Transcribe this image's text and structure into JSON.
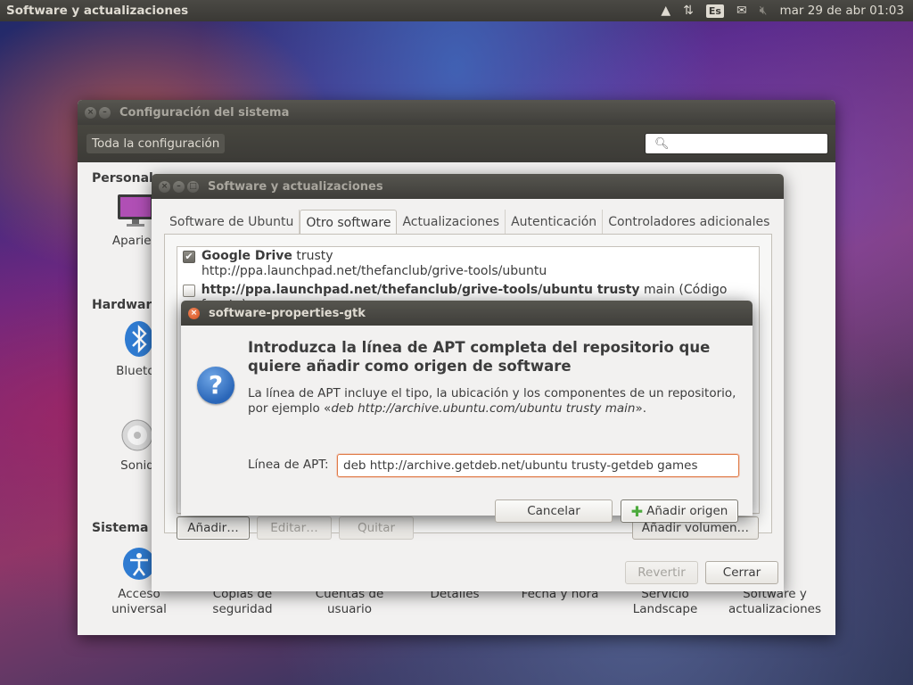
{
  "top_panel": {
    "app_title": "Software y actualizaciones",
    "language": "Es",
    "clock": "mar 29 de abr 01:03"
  },
  "settings": {
    "title": "Configuración del sistema",
    "all_settings": "Toda la configuración",
    "search_placeholder": "",
    "sections": {
      "personal": "Personal",
      "hardware": "Hardware",
      "system": "Sistema"
    },
    "personal_items": [
      "Aparien"
    ],
    "hardware_items": [
      "Bluetoo",
      "Sonid"
    ],
    "system_items": [
      {
        "line1": "Acceso",
        "line2": "universal"
      },
      {
        "line1": "Copias de",
        "line2": "seguridad"
      },
      {
        "line1": "Cuentas de",
        "line2": "usuario"
      },
      {
        "line1": "Detalles",
        "line2": ""
      },
      {
        "line1": "Fecha y hora",
        "line2": ""
      },
      {
        "line1": "Servicio",
        "line2": "Landscape"
      },
      {
        "line1": "Software y",
        "line2": "actualizaciones"
      }
    ]
  },
  "software": {
    "title": "Software y actualizaciones",
    "tabs": [
      "Software de Ubuntu",
      "Otro software",
      "Actualizaciones",
      "Autenticación",
      "Controladores adicionales"
    ],
    "active_tab": "Otro software",
    "repos": [
      {
        "name": "Google Drive",
        "suffix": " trusty",
        "url": "http://ppa.launchpad.net/thefanclub/grive-tools/ubuntu",
        "checked": "✔"
      },
      {
        "name": "http://ppa.launchpad.net/thefanclub/grive-tools/ubuntu trusty",
        "suffix": " main (Código fuente)",
        "url": "",
        "checked": ""
      }
    ],
    "buttons": {
      "add": "Añadir…",
      "edit": "Editar…",
      "remove": "Quitar",
      "add_volume": "Añadir volumen…",
      "revert": "Revertir",
      "close": "Cerrar"
    }
  },
  "dialog": {
    "title": "software-properties-gtk",
    "heading": "Introduzca la línea de APT completa del repositorio que quiere añadir como origen de software",
    "desc_line1": "La línea de APT incluye el tipo, la ubicación y los componentes de un repositorio,",
    "desc_prefix": "por ejemplo «",
    "desc_example": "deb http://archive.ubuntu.com/ubuntu trusty main",
    "desc_suffix": "».",
    "apt_label": "Línea de APT:",
    "apt_value": "deb http://archive.getdeb.net/ubuntu trusty-getdeb games",
    "cancel": "Cancelar",
    "add_source": "Añadir origen"
  }
}
